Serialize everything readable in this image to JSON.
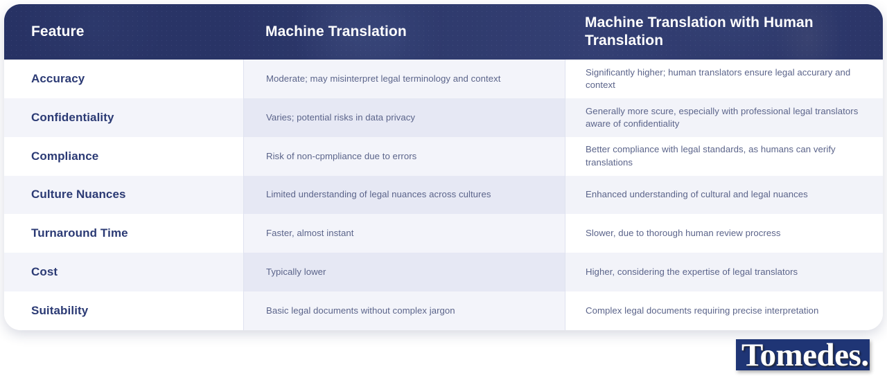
{
  "table": {
    "columns": [
      {
        "key": "feature",
        "label": "Feature"
      },
      {
        "key": "mt",
        "label": "Machine Translation"
      },
      {
        "key": "mtph",
        "label": "Machine Translation with Human Translation"
      }
    ],
    "rows": [
      {
        "feature": "Accuracy",
        "mt": "Moderate; may misinterpret legal terminology and context",
        "mtph": "Significantly higher; human translators ensure legal accurary and context"
      },
      {
        "feature": "Confidentiality",
        "mt": "Varies; potential risks in data privacy",
        "mtph": "Generally more scure, especially with professional legal translators aware of confidentiality"
      },
      {
        "feature": "Compliance",
        "mt": "Risk of non-cpmpliance due to errors",
        "mtph": "Better compliance with legal standards, as humans can verify translations"
      },
      {
        "feature": "Culture Nuances",
        "mt": "Limited understanding of legal nuances across cultures",
        "mtph": "Enhanced understanding of cultural and legal nuances"
      },
      {
        "feature": "Turnaround Time",
        "mt": "Faster, almost instant",
        "mtph": "Slower, due to thorough human review procress"
      },
      {
        "feature": "Cost",
        "mt": "Typically lower",
        "mtph": "Higher, considering the expertise of legal translators"
      },
      {
        "feature": "Suitability",
        "mt": "Basic legal documents without complex jargon",
        "mtph": "Complex legal documents requiring precise interpretation"
      }
    ]
  },
  "branding": {
    "logo_text": "Tomedes.",
    "logo_bg_color": "#1f3575",
    "logo_text_color": "#ffffff"
  },
  "theme": {
    "header_bg": "#2a3568",
    "header_text": "#ffffff",
    "feature_text": "#2b3a74",
    "body_text": "#5b648a",
    "row_white": "#ffffff",
    "row_tint": "#f3f4fa",
    "row_tint_strong": "#e6e8f4",
    "divider": "#dfe2ef"
  }
}
